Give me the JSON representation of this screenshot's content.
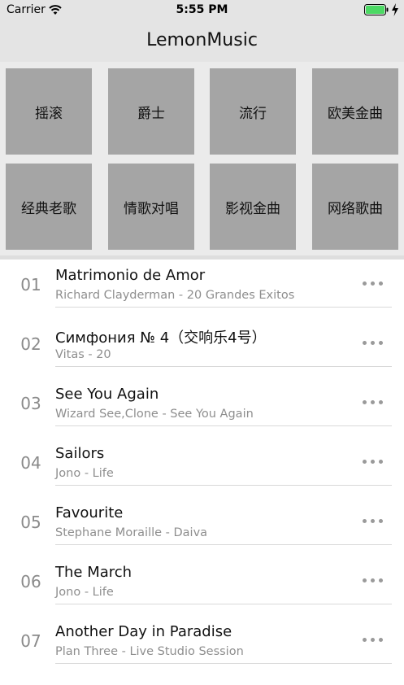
{
  "status_bar": {
    "carrier": "Carrier",
    "time": "5:55 PM"
  },
  "nav": {
    "title": "LemonMusic"
  },
  "categories": [
    "摇滚",
    "爵士",
    "流行",
    "欧美金曲",
    "经典老歌",
    "情歌对唱",
    "影视金曲",
    "网络歌曲"
  ],
  "songs": [
    {
      "num": "01",
      "title": "Matrimonio de Amor",
      "subtitle": "Richard Clayderman - 20 Grandes Exitos"
    },
    {
      "num": "02",
      "title": "Симфония № 4（交响乐4号）",
      "subtitle": "Vitas - 20"
    },
    {
      "num": "03",
      "title": "See You Again",
      "subtitle": "Wizard See,Clone - See You Again"
    },
    {
      "num": "04",
      "title": "Sailors",
      "subtitle": "Jono - Life"
    },
    {
      "num": "05",
      "title": "Favourite",
      "subtitle": "Stephane Moraille - Daiva"
    },
    {
      "num": "06",
      "title": "The March",
      "subtitle": "Jono - Life"
    },
    {
      "num": "07",
      "title": "Another Day in Paradise",
      "subtitle": "Plan Three - Live Studio Session"
    }
  ],
  "icons": {
    "wifi": "wifi-icon",
    "battery": "battery-icon",
    "charging": "charging-bolt-icon",
    "more": "more-dots-icon"
  },
  "colors": {
    "bar_bg": "#e4e4e4",
    "tile_bg": "#a5a5a5",
    "battery_fill": "#4cd964"
  }
}
